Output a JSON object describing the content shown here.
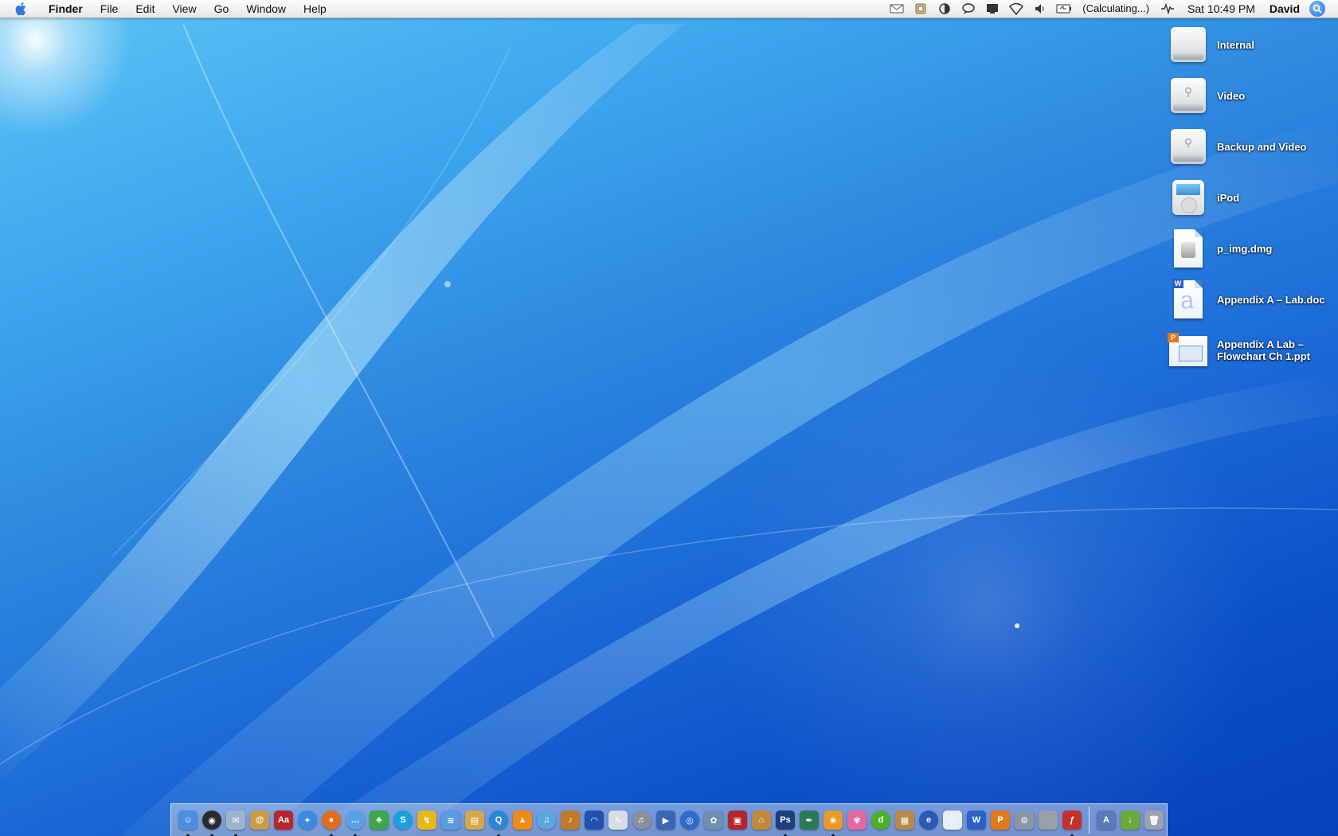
{
  "menubar": {
    "app_name": "Finder",
    "menus": [
      "File",
      "Edit",
      "View",
      "Go",
      "Window",
      "Help"
    ],
    "battery_status": "(Calculating...)",
    "clock": "Sat 10:49 PM",
    "user": "David"
  },
  "desktop_icons": [
    {
      "label": "Internal",
      "icon": "internal-drive-icon"
    },
    {
      "label": "Video",
      "icon": "usb-drive-icon"
    },
    {
      "label": "Backup and Video",
      "icon": "usb-drive-icon"
    },
    {
      "label": "iPod",
      "icon": "ipod-icon"
    },
    {
      "label": "p_img.dmg",
      "icon": "disk-image-icon"
    },
    {
      "label": "Appendix A – Lab.doc",
      "icon": "word-document-icon"
    },
    {
      "label": "Appendix A Lab – Flowchart Ch 1.ppt",
      "icon": "powerpoint-document-icon"
    }
  ],
  "dock": {
    "apps": [
      {
        "icon": "finder-icon",
        "color": "#4a8fe0",
        "glyph": "☺",
        "running": true
      },
      {
        "icon": "dashboard-icon",
        "color": "#2b2b2b",
        "glyph": "◉",
        "running": true,
        "round": true
      },
      {
        "icon": "mail-icon",
        "color": "#9db4cc",
        "glyph": "✉",
        "running": true
      },
      {
        "icon": "address-book-icon",
        "color": "#c89a4a",
        "glyph": "@"
      },
      {
        "icon": "dictionary-icon",
        "color": "#b8262a",
        "glyph": "Aa"
      },
      {
        "icon": "safari-icon",
        "color": "#3a8be0",
        "glyph": "✦",
        "round": true
      },
      {
        "icon": "firefox-icon",
        "color": "#e36d1a",
        "glyph": "●",
        "running": true,
        "round": true
      },
      {
        "icon": "ichat-icon",
        "color": "#5aa0e6",
        "glyph": "…",
        "running": true,
        "round": true
      },
      {
        "icon": "adium-icon",
        "color": "#3aa84a",
        "glyph": "♣"
      },
      {
        "icon": "skype-icon",
        "color": "#1aa0e0",
        "glyph": "S",
        "round": true
      },
      {
        "icon": "transmit-icon",
        "color": "#e8b81a",
        "glyph": "↯"
      },
      {
        "icon": "airport-utility-icon",
        "color": "#5a9adf",
        "glyph": "≋"
      },
      {
        "icon": "preview-icon",
        "color": "#d6a84a",
        "glyph": "▤"
      },
      {
        "icon": "quicktime-icon",
        "color": "#2a86d8",
        "glyph": "Q",
        "running": true,
        "round": true
      },
      {
        "icon": "vlc-icon",
        "color": "#f08a12",
        "glyph": "▲"
      },
      {
        "icon": "itunes-icon",
        "color": "#5aa8e0",
        "glyph": "♫",
        "round": true
      },
      {
        "icon": "garageband-icon",
        "color": "#c07a2a",
        "glyph": "♪"
      },
      {
        "icon": "audio-player-icon",
        "color": "#2050b0",
        "glyph": "◠"
      },
      {
        "icon": "textedit-icon",
        "color": "#d8dde6",
        "glyph": "✎"
      },
      {
        "icon": "piano-icon",
        "color": "#8a8f99",
        "glyph": "♬",
        "round": true
      },
      {
        "icon": "imovie-icon",
        "color": "#3a66b8",
        "glyph": "▶"
      },
      {
        "icon": "idvd-icon",
        "color": "#2b6ec8",
        "glyph": "◎",
        "round": true
      },
      {
        "icon": "iphoto-icon",
        "color": "#6e8fb0",
        "glyph": "✿"
      },
      {
        "icon": "photo-booth-icon",
        "color": "#b8242a",
        "glyph": "▣"
      },
      {
        "icon": "image-capture-icon",
        "color": "#c08a3a",
        "glyph": "⌂"
      },
      {
        "icon": "photoshop-icon",
        "color": "#1d3f7a",
        "glyph": "Ps",
        "running": true
      },
      {
        "icon": "illustrator-pen-icon",
        "color": "#2a7a5a",
        "glyph": "✒"
      },
      {
        "icon": "flower-app-icon",
        "color": "#e89a2a",
        "glyph": "❀",
        "running": true
      },
      {
        "icon": "pinwheel-app-icon",
        "color": "#e06aa0",
        "glyph": "✾"
      },
      {
        "icon": "dreamweaver-icon",
        "color": "#4ab02a",
        "glyph": "d",
        "round": true
      },
      {
        "icon": "keynote-icon",
        "color": "#b88a4a",
        "glyph": "▦"
      },
      {
        "icon": "ie-icon",
        "color": "#2a5ab8",
        "glyph": "e",
        "round": true
      },
      {
        "icon": "pages-icon",
        "color": "#e8eef6",
        "glyph": "▭"
      },
      {
        "icon": "word-icon",
        "color": "#2a62c8",
        "glyph": "W"
      },
      {
        "icon": "powerpoint-icon",
        "color": "#e07a1a",
        "glyph": "P"
      },
      {
        "icon": "automator-icon",
        "color": "#8a96a8",
        "glyph": "⚙"
      },
      {
        "icon": "system-prefs-icon",
        "color": "#9aa0a8",
        "glyph": ""
      },
      {
        "icon": "flash-icon",
        "color": "#c8302a",
        "glyph": "ƒ",
        "running": true
      }
    ],
    "docs": [
      {
        "icon": "applications-stack-icon",
        "color": "#5a7ab8",
        "glyph": "A"
      },
      {
        "icon": "downloads-stack-icon",
        "color": "#6aaa3a",
        "glyph": "↓"
      },
      {
        "icon": "trash-icon",
        "color": "#9aa4b0",
        "glyph": "🗑"
      }
    ]
  }
}
